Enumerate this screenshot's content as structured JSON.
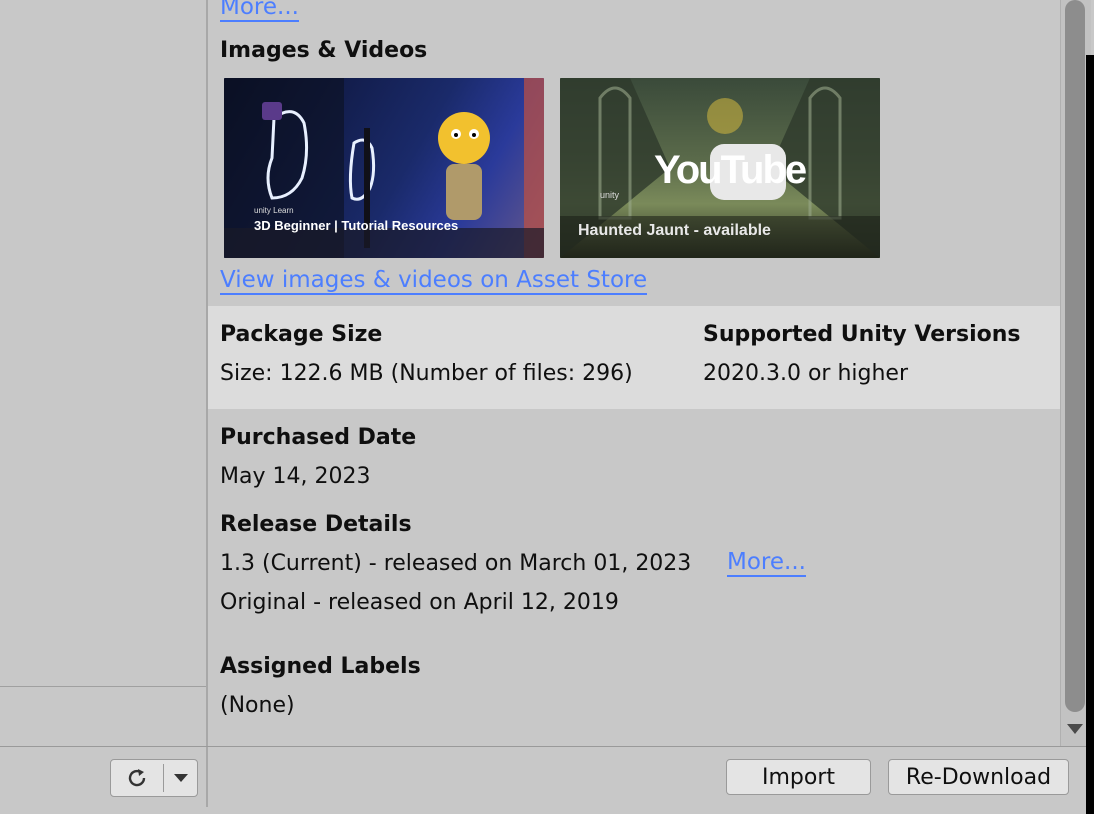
{
  "top_more_link": "More...",
  "images": {
    "heading": "Images & Videos",
    "thumbnails": [
      {
        "icon": "tutorial-thumbnail",
        "caption": "3D Beginner | Tutorial Resources",
        "badge": "unity Learn"
      },
      {
        "icon": "youtube-video-thumbnail",
        "caption": "Haunted Jaunt - available",
        "logo": "YouTube",
        "badge": "unity"
      }
    ],
    "view_link": "View images & videos on Asset Store"
  },
  "package_size": {
    "heading": "Package Size",
    "value": "Size: 122.6 MB (Number of files: 296)"
  },
  "supported_versions": {
    "heading": "Supported Unity Versions",
    "value": "2020.3.0 or higher"
  },
  "purchased": {
    "heading": "Purchased Date",
    "value": "May 14, 2023"
  },
  "release": {
    "heading": "Release Details",
    "current": "1.3 (Current) - released on March 01, 2023",
    "more_link": "More...",
    "original": "Original - released on April 12, 2019"
  },
  "labels": {
    "heading": "Assigned Labels",
    "value": "(None)"
  },
  "footer": {
    "refresh_icon": "refresh-icon",
    "dropdown_icon": "chevron-down-icon",
    "import_label": "Import",
    "redownload_label": "Re-Download"
  },
  "colors": {
    "link": "#4c7eff",
    "panel": "#c8c8c8",
    "band": "#dcdcdc"
  }
}
